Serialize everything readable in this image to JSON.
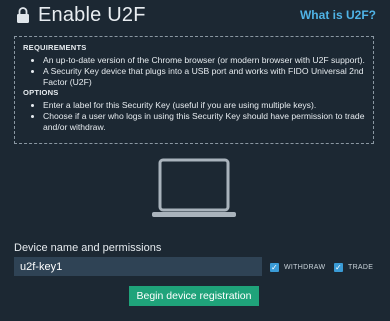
{
  "header": {
    "title": "Enable U2F",
    "help_link": "What is U2F?"
  },
  "info": {
    "requirements_heading": "REQUIREMENTS",
    "requirements": [
      "An up-to-date version of the Chrome browser (or modern browser with U2F support).",
      "A Security Key device that plugs into a USB port and works with FIDO Universal 2nd Factor (U2F)"
    ],
    "options_heading": "OPTIONS",
    "options": [
      "Enter a label for this Security Key (useful if you are using multiple keys).",
      "Choose if a user who logs in using this Security Key should have permission to trade and/or withdraw."
    ]
  },
  "device": {
    "label": "Device name and permissions",
    "name_value": "u2f-key1",
    "permissions": [
      {
        "label": "WITHDRAW",
        "checked": true
      },
      {
        "label": "TRADE",
        "checked": true
      }
    ]
  },
  "actions": {
    "register_label": "Begin device registration"
  },
  "colors": {
    "background": "#1c2833",
    "accent_link": "#4fb3e6",
    "button": "#1fa37a",
    "input_bg": "#2f4355"
  },
  "icons": {
    "header": "lock-icon",
    "illustration": "laptop-icon",
    "permission_box": "checkbox-checked-icon"
  }
}
